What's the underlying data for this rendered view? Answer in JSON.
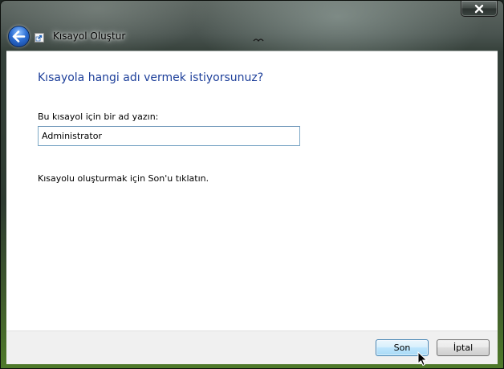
{
  "window": {
    "title": "Kısayol Oluştur",
    "close_glyph": "✕"
  },
  "content": {
    "heading": "Kısayola hangi adı vermek istiyorsunuz?",
    "field_label": "Bu kısayol için bir ad yazın:",
    "name_value": "Administrator",
    "hint": "Kısayolu oluşturmak için Son'u tıklatın."
  },
  "footer": {
    "finish_label": "Son",
    "cancel_label": "İptal"
  },
  "icons": {
    "back": "back-arrow-icon",
    "app": "shortcut-icon",
    "close": "close-icon",
    "cursor": "mouse-pointer-icon"
  },
  "colors": {
    "heading": "#1d3f9a",
    "input_border": "#7fa9c7",
    "default_button": "#a7d9f5"
  }
}
